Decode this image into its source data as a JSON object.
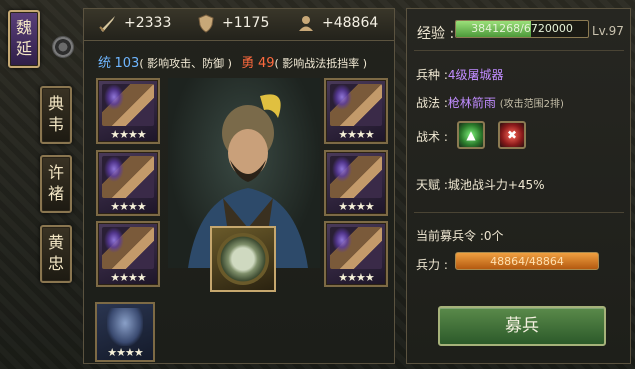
{
  "faction_tab": {
    "chars": [
      "魏",
      "延"
    ]
  },
  "general_tabs": [
    {
      "chars": [
        "典",
        "韦"
      ]
    },
    {
      "chars": [
        "许",
        "褚"
      ]
    },
    {
      "chars": [
        "黄",
        "忠"
      ]
    }
  ],
  "stats": {
    "attack": "+2333",
    "defense": "+1175",
    "troops": "+48864"
  },
  "info": {
    "lead_label": "统",
    "lead_value": "103",
    "lead_desc": "( 影响攻击、防御 )",
    "brave_label": "勇",
    "brave_value": "49",
    "brave_desc": "( 影响战法抵挡率 )"
  },
  "equipment": {
    "stars": "★★★★"
  },
  "exp": {
    "label": "经验 :",
    "value": "3841268/6720000",
    "fraction": 0.5716,
    "level": "Lv.97"
  },
  "unit": {
    "label": "兵种 :",
    "value": "4级屠城器"
  },
  "skill": {
    "label": "战法 :",
    "value": "枪林箭雨",
    "desc": "(攻击范围2排)"
  },
  "tactics": {
    "label": "战术 :",
    "icons": [
      "green-triangle-icon",
      "red-cross-icon"
    ]
  },
  "talent": {
    "label": "天赋 :",
    "value": "城池战斗力+45%"
  },
  "recruit_orders": {
    "label": "当前募兵令 :",
    "value": "0个"
  },
  "force": {
    "label": "兵力 :",
    "value": "48864/48864",
    "fraction": 1.0
  },
  "recruit_button": "募兵",
  "colors": {
    "accent_gold": "#c6a76e",
    "exp_green": "#6cc04a",
    "force_orange": "#e08a2a",
    "button_green": "#4a7a3a"
  }
}
